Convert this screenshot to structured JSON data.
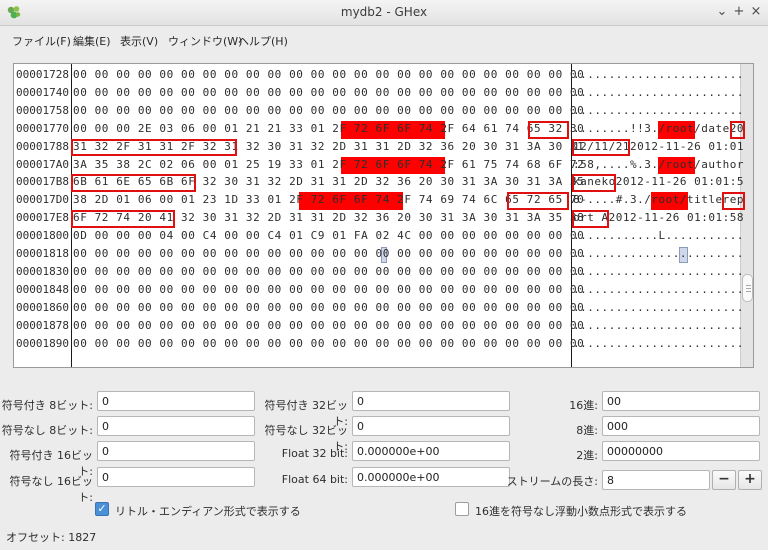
{
  "window": {
    "title": "mydb2 - GHex",
    "controls": [
      "⌄",
      "+",
      "×"
    ]
  },
  "menu": [
    "ファイル(F)",
    "編集(E)",
    "表示(V)",
    "ウィンドウ(W)",
    "ヘルプ(H)"
  ],
  "hex": {
    "rows": [
      {
        "offset": "00001728",
        "hex": "00 00 00 00 00 00 00 00 00 00 00 00 00 00 00 00 00 00 00 00 00 00 00 00",
        "ascii": "........................"
      },
      {
        "offset": "00001740",
        "hex": "00 00 00 00 00 00 00 00 00 00 00 00 00 00 00 00 00 00 00 00 00 00 00 00",
        "ascii": "........................"
      },
      {
        "offset": "00001758",
        "hex": "00 00 00 00 00 00 00 00 00 00 00 00 00 00 00 00 00 00 00 00 00 00 00 00",
        "ascii": "........................"
      },
      {
        "offset": "00001770",
        "hex": "00 00 00 2E 03 06 00 01 21 21 33 01 2F 72 6F 6F 74 2F 64 61 74 65 32 30",
        "ascii": "........!!3./root/date20"
      },
      {
        "offset": "00001788",
        "hex": "31 32 2F 31 31 2F 32 31 32 30 31 32 2D 31 31 2D 32 36 20 30 31 3A 30 31",
        "ascii": "12/11/212012-11-26 01:01"
      },
      {
        "offset": "000017A0",
        "hex": "3A 35 38 2C 02 06 00 01 25 19 33 01 2F 72 6F 6F 74 2F 61 75 74 68 6F 72",
        "ascii": ":58,....%.3./root/author"
      },
      {
        "offset": "000017B8",
        "hex": "6B 61 6E 65 6B 6F 32 30 31 32 2D 31 31 2D 32 36 20 30 31 3A 30 31 3A 35",
        "ascii": "kaneko2012-11-26 01:01:5"
      },
      {
        "offset": "000017D0",
        "hex": "38 2D 01 06 00 01 23 1D 33 01 2F 72 6F 6F 74 2F 74 69 74 6C 65 72 65 70",
        "ascii": "8-....#.3./root/titlerep"
      },
      {
        "offset": "000017E8",
        "hex": "6F 72 74 20 41 32 30 31 32 2D 31 31 2D 32 36 20 30 31 3A 30 31 3A 35 38",
        "ascii": "ort A2012-11-26 01:01:58"
      },
      {
        "offset": "00001800",
        "hex": "0D 00 00 00 04 00 C4 00 00 C4 01 C9 01 FA 02 4C 00 00 00 00 00 00 00 00",
        "ascii": "............L..........."
      },
      {
        "offset": "00001818",
        "hex": "00 00 00 00 00 00 00 00 00 00 00 00 00 00 00 00 00 00 00 00 00 00 00 00",
        "ascii": "........................"
      },
      {
        "offset": "00001830",
        "hex": "00 00 00 00 00 00 00 00 00 00 00 00 00 00 00 00 00 00 00 00 00 00 00 00",
        "ascii": "........................"
      },
      {
        "offset": "00001848",
        "hex": "00 00 00 00 00 00 00 00 00 00 00 00 00 00 00 00 00 00 00 00 00 00 00 00",
        "ascii": "........................"
      },
      {
        "offset": "00001860",
        "hex": "00 00 00 00 00 00 00 00 00 00 00 00 00 00 00 00 00 00 00 00 00 00 00 00",
        "ascii": "........................"
      },
      {
        "offset": "00001878",
        "hex": "00 00 00 00 00 00 00 00 00 00 00 00 00 00 00 00 00 00 00 00 00 00 00 00",
        "ascii": "........................"
      },
      {
        "offset": "00001890",
        "hex": "00 00 00 00 00 00 00 00 00 00 00 00 00 00 00 00 00 00 00 00 00 00 00 00",
        "ascii": "........................"
      }
    ],
    "highlight_color": "#ff0000",
    "box_color": "#e01010"
  },
  "fields": {
    "signed8": {
      "label": "符号付き 8ビット:",
      "value": "0"
    },
    "unsigned8": {
      "label": "符号なし 8ビット:",
      "value": "0"
    },
    "signed16": {
      "label": "符号付き 16ビット:",
      "value": "0"
    },
    "unsigned16": {
      "label": "符号なし 16ビット:",
      "value": "0"
    },
    "signed32": {
      "label": "符号付き 32ビット:",
      "value": "0"
    },
    "unsigned32": {
      "label": "符号なし 32ビット:",
      "value": "0"
    },
    "float32": {
      "label": "Float 32 bit:",
      "value": "0.000000e+00"
    },
    "float64": {
      "label": "Float 64 bit:",
      "value": "0.000000e+00"
    },
    "hex": {
      "label": "16進:",
      "value": "00"
    },
    "oct": {
      "label": "8進:",
      "value": "000"
    },
    "bin": {
      "label": "2進:",
      "value": "00000000"
    },
    "stream_length": {
      "label": "ストリームの長さ:",
      "value": "8"
    }
  },
  "stepper": {
    "minus": "−",
    "plus": "+"
  },
  "checkboxes": {
    "little_endian": {
      "label": "リトル・エンディアン形式で表示する",
      "checked": true
    },
    "unsigned_float_hex": {
      "label": "16進を符号なし浮動小数点形式で表示する",
      "checked": false
    }
  },
  "status": {
    "offset_text": "オフセット: 1827"
  }
}
